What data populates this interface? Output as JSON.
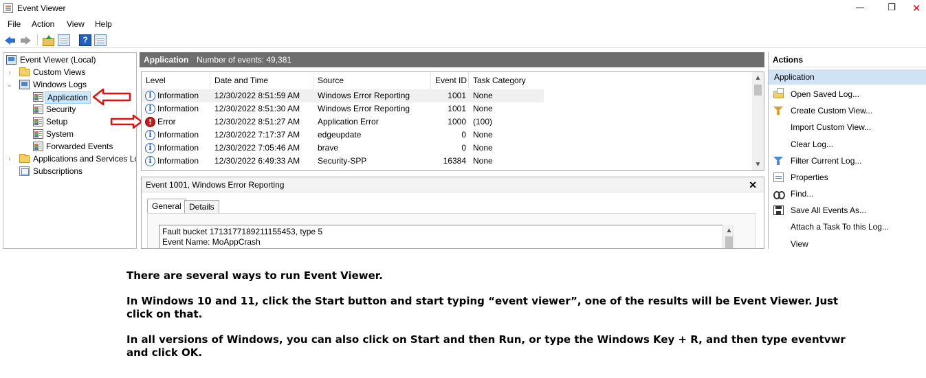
{
  "window": {
    "title": "Event Viewer",
    "controls": {
      "minimize": "—",
      "maximize": "❐",
      "close": "✕"
    }
  },
  "menu": [
    "File",
    "Action",
    "View",
    "Help"
  ],
  "toolbar": {
    "icons": [
      "back-arrow-icon",
      "forward-arrow-icon",
      "folder-up-icon",
      "properties-icon",
      "help-icon",
      "show-hide-pane-icon"
    ],
    "help_glyph": "?"
  },
  "tree": {
    "root": "Event Viewer (Local)",
    "custom_views": "Custom Views",
    "windows_logs": "Windows Logs",
    "logs": [
      "Application",
      "Security",
      "Setup",
      "System",
      "Forwarded Events"
    ],
    "apps_services": "Applications and Services Lo",
    "subscriptions": "Subscriptions",
    "expander_collapsed": "›",
    "expander_expanded": "⌄"
  },
  "center": {
    "title": "Application",
    "count_label": "Number of events: 49,381",
    "columns": [
      "Level",
      "Date and Time",
      "Source",
      "Event ID",
      "Task Category"
    ],
    "rows": [
      {
        "level": "Information",
        "icon": "info",
        "date": "12/30/2022 8:51:59 AM",
        "source": "Windows Error Reporting",
        "id": "1001",
        "task": "None"
      },
      {
        "level": "Information",
        "icon": "info",
        "date": "12/30/2022 8:51:30 AM",
        "source": "Windows Error Reporting",
        "id": "1001",
        "task": "None"
      },
      {
        "level": "Error",
        "icon": "error",
        "date": "12/30/2022 8:51:27 AM",
        "source": "Application Error",
        "id": "1000",
        "task": "(100)"
      },
      {
        "level": "Information",
        "icon": "info",
        "date": "12/30/2022 7:17:37 AM",
        "source": "edgeupdate",
        "id": "0",
        "task": "None"
      },
      {
        "level": "Information",
        "icon": "info",
        "date": "12/30/2022 7:05:46 AM",
        "source": "brave",
        "id": "0",
        "task": "None"
      },
      {
        "level": "Information",
        "icon": "info",
        "date": "12/30/2022 6:49:33 AM",
        "source": "Security-SPP",
        "id": "16384",
        "task": "None"
      }
    ]
  },
  "detail": {
    "title": "Event 1001, Windows Error Reporting",
    "close": "✕",
    "tabs": [
      "General",
      "Details"
    ],
    "lines": [
      "Fault bucket 1713177189211155453, type 5",
      "Event Name: MoAppCrash"
    ]
  },
  "actions": {
    "title": "Actions",
    "section": "Application",
    "items": [
      {
        "label": "Open Saved Log...",
        "icon": "open-folder-icon"
      },
      {
        "label": "Create Custom View...",
        "icon": "filter-icon"
      },
      {
        "label": "Import Custom View...",
        "icon": ""
      },
      {
        "label": "Clear Log...",
        "icon": ""
      },
      {
        "label": "Filter Current Log...",
        "icon": "filter-icon"
      },
      {
        "label": "Properties",
        "icon": "properties-icon"
      },
      {
        "label": "Find...",
        "icon": "binoculars-icon"
      },
      {
        "label": "Save All Events As...",
        "icon": "save-icon"
      },
      {
        "label": "Attach a Task To this Log...",
        "icon": ""
      },
      {
        "label": "View",
        "icon": ""
      }
    ]
  },
  "caption": [
    "There are several ways to run Event Viewer.",
    "In Windows 10 and 11, click the Start button and start typing “event viewer”, one of the results will be Event Viewer. Just click on that.",
    "In all versions of Windows, you can also click on Start and then Run, or type the Windows Key + R, and then type eventvwr and click OK."
  ],
  "colors": {
    "header_bg": "#6e6e6e",
    "selection": "#cce8ff",
    "actions_section": "#cfe3f5",
    "arrow_red": "#e01010",
    "error_red": "#c41b1b",
    "info_blue": "#2862b8"
  }
}
